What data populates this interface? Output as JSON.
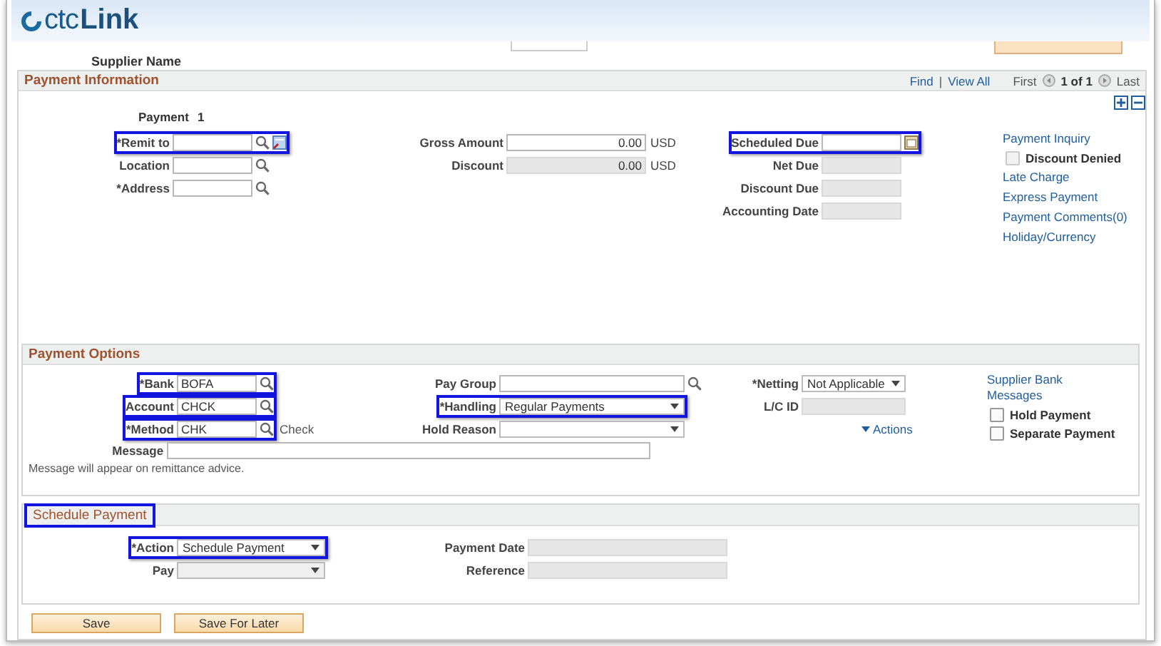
{
  "logo": {
    "part_a": "ctc",
    "part_b": "Link"
  },
  "supplier_label": "Supplier Name",
  "payment_information": {
    "title": "Payment Information",
    "nav": {
      "find": "Find",
      "separator": "|",
      "view_all": "View All",
      "first": "First",
      "count": "1 of 1",
      "last": "Last"
    },
    "payment_label": "Payment",
    "payment_number": "1",
    "col1": [
      {
        "kind": "text",
        "label": "*Remit to",
        "lookup": true,
        "extra_icon": true,
        "highlighted": true
      },
      {
        "kind": "text",
        "label": "Location",
        "lookup": true,
        "highlighted": false
      },
      {
        "kind": "text",
        "label": "*Address",
        "lookup": true,
        "highlighted": false
      }
    ],
    "col2": [
      {
        "kind": "amount",
        "label": "Gross Amount",
        "value": "0.00",
        "currency": "USD",
        "disabled": false,
        "highlighted": false
      },
      {
        "kind": "amount",
        "label": "Discount",
        "value": "0.00",
        "currency": "USD",
        "disabled": true,
        "highlighted": false
      }
    ],
    "col3": [
      {
        "kind": "date",
        "label": "Scheduled Due",
        "highlighted": true
      },
      {
        "kind": "readonly",
        "label": "Net Due",
        "highlighted": false
      },
      {
        "kind": "readonly",
        "label": "Discount Due",
        "highlighted": false
      },
      {
        "kind": "readonly",
        "label": "Accounting Date",
        "highlighted": false
      }
    ],
    "links": [
      {
        "kind": "link",
        "text": "Payment Inquiry"
      },
      {
        "kind": "checkbox",
        "text": "Discount Denied",
        "checked": false,
        "disabled": true
      },
      {
        "kind": "link",
        "text": "Late Charge"
      },
      {
        "kind": "link",
        "text": "Express Payment"
      },
      {
        "kind": "link",
        "text": "Payment Comments(0)"
      },
      {
        "kind": "link",
        "text": "Holiday/Currency"
      }
    ]
  },
  "payment_options": {
    "title": "Payment Options",
    "col1": [
      {
        "kind": "text",
        "label": "*Bank",
        "value": "BOFA",
        "lookup": true,
        "highlighted": true
      },
      {
        "kind": "text",
        "label": "Account",
        "value": "CHCK",
        "lookup": true,
        "highlighted": true
      },
      {
        "kind": "text",
        "label": "*Method",
        "value": "CHK",
        "lookup": true,
        "suffix": "Check",
        "highlighted": true
      }
    ],
    "message": {
      "label": "Message"
    },
    "note": "Message will appear on remittance advice.",
    "col2": [
      {
        "kind": "text",
        "label": "Pay Group",
        "lookup": true,
        "highlighted": false
      },
      {
        "kind": "select",
        "label": "*Handling",
        "value": "Regular Payments",
        "highlighted": true
      },
      {
        "kind": "select",
        "label": "Hold Reason",
        "highlighted": false
      }
    ],
    "col3": [
      {
        "kind": "select",
        "label": "*Netting",
        "value": "Not Applicable",
        "highlighted": false
      },
      {
        "kind": "readonly",
        "label": "L/C ID",
        "highlighted": false
      }
    ],
    "actions": "Actions",
    "links": [
      {
        "kind": "link",
        "text": "Supplier Bank Messages"
      },
      {
        "kind": "checkbox",
        "text": "Hold Payment",
        "checked": false,
        "disabled": false
      },
      {
        "kind": "checkbox",
        "text": "Separate Payment",
        "checked": false,
        "disabled": false
      }
    ]
  },
  "schedule_payment": {
    "title": "Schedule Payment",
    "title_highlighted": true,
    "col1": [
      {
        "kind": "select",
        "label": "*Action",
        "value": "Schedule Payment",
        "highlighted": true
      },
      {
        "kind": "select",
        "label": "Pay",
        "disabled": true,
        "highlighted": false
      }
    ],
    "col2": [
      {
        "kind": "readonly",
        "label": "Payment Date",
        "highlighted": false
      },
      {
        "kind": "readonly",
        "label": "Reference",
        "highlighted": false
      }
    ]
  },
  "buttons": [
    "Save",
    "Save For Later"
  ]
}
